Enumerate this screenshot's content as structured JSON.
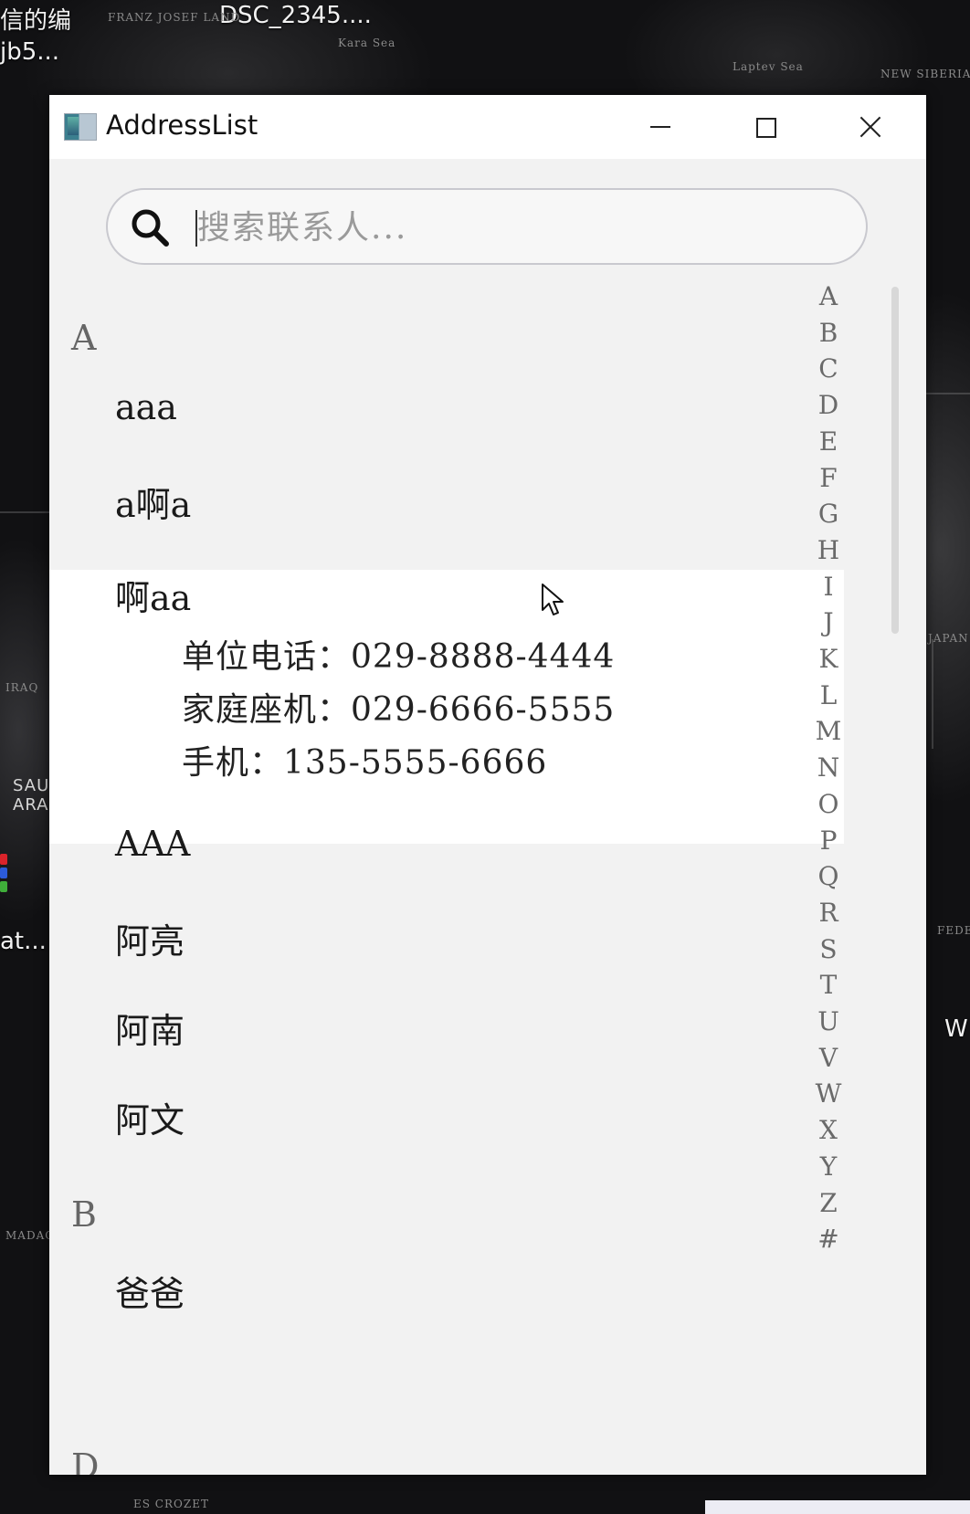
{
  "desktop": {
    "items": [
      {
        "label": "信的编"
      },
      {
        "label": "jb5..."
      },
      {
        "label": "DSC_2345...."
      },
      {
        "label": "at..."
      },
      {
        "label": "W"
      }
    ],
    "map_labels": [
      "FRANZ JOSEF LAND",
      "Kara Sea",
      "Laptev Sea",
      "NEW SIBERIAN",
      "IRAQ",
      "SAU ARA",
      "JAPAN",
      "FEDER",
      "MADAG",
      "ES CROZET"
    ]
  },
  "window": {
    "title": "AddressList",
    "search": {
      "placeholder": "搜索联系人..."
    },
    "sections": [
      {
        "letter": "A",
        "contacts": [
          "aaa",
          "a啊a",
          "啊aa",
          "AAA",
          "阿亮",
          "阿南",
          "阿文"
        ]
      },
      {
        "letter": "B",
        "contacts": [
          "爸爸"
        ]
      },
      {
        "letter": "D",
        "contacts": []
      }
    ],
    "expanded_contact": {
      "name": "啊aa",
      "details": [
        "单位电话：029-8888-4444",
        "家庭座机：029-6666-5555",
        "手机：135-5555-6666"
      ]
    },
    "index_letters": [
      "A",
      "B",
      "C",
      "D",
      "E",
      "F",
      "G",
      "H",
      "I",
      "J",
      "K",
      "L",
      "M",
      "N",
      "O",
      "P",
      "Q",
      "R",
      "S",
      "T",
      "U",
      "V",
      "W",
      "X",
      "Y",
      "Z",
      "#"
    ]
  },
  "colors": {
    "window_bg": "#f2f2f2",
    "titlebar_bg": "#ffffff",
    "expanded_bg": "#ffffff",
    "index_text": "#6a6a6a",
    "section_header_text": "#666666"
  },
  "icons": [
    "app-icon",
    "minimize-icon",
    "maximize-icon",
    "close-icon",
    "search-icon",
    "mouse-cursor-icon"
  ]
}
